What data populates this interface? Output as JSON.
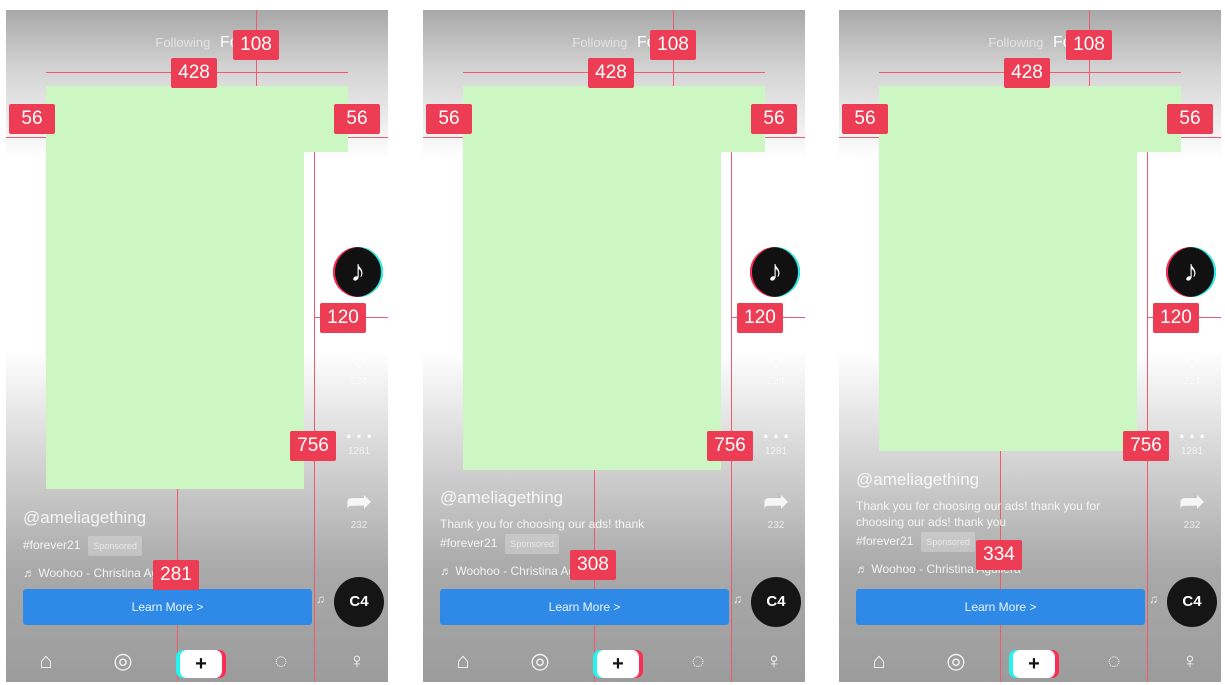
{
  "feed_tabs": {
    "following": "Following",
    "for_you": "Fo"
  },
  "brand_icon": {
    "name": "tiktok-logo",
    "glyph": "♪"
  },
  "side_actions": {
    "like": {
      "icon": "heart-icon",
      "glyph": "♡",
      "count": "224"
    },
    "comment": {
      "icon": "comment-icon",
      "glyph": "…",
      "count": "1281"
    },
    "share": {
      "icon": "share-icon",
      "glyph": "➦",
      "count": "232"
    }
  },
  "disc": {
    "icon": "music-disc-icon",
    "label": "C4"
  },
  "caption": {
    "username": "@ameliagething",
    "hashtag": "#forever21",
    "sponsored": "Sponsored",
    "music": "♬ Woohoo - Christina Aguilera",
    "description": "Thank you for choosing our ads! thank",
    "description_long": "Thank you for choosing our ads! thank you for choosing our ads! thank you"
  },
  "cta": {
    "label": "Learn More >"
  },
  "bottom_nav": {
    "home": {
      "icon": "home-icon",
      "glyph": "⌂"
    },
    "discover": {
      "icon": "discover-icon",
      "glyph": "◎"
    },
    "create": {
      "icon": "create-icon",
      "glyph": "+"
    },
    "inbox": {
      "icon": "inbox-icon",
      "glyph": "◌"
    },
    "me": {
      "icon": "profile-icon",
      "glyph": "♀"
    }
  },
  "measurements": {
    "top_offset": "108",
    "safe_width": "428",
    "left_margin": "56",
    "right_margin": "56",
    "side_column": "120",
    "lower_column": "756",
    "bottom_panel_1": "281",
    "bottom_panel_2": "308",
    "bottom_panel_3": "334"
  },
  "colors": {
    "safe_zone": "#ccf7c3",
    "guide_badge": "#ec3d54",
    "cta_button": "#2e8ae6",
    "accent_cyan": "#25f4ee",
    "accent_red": "#fe2c55"
  }
}
